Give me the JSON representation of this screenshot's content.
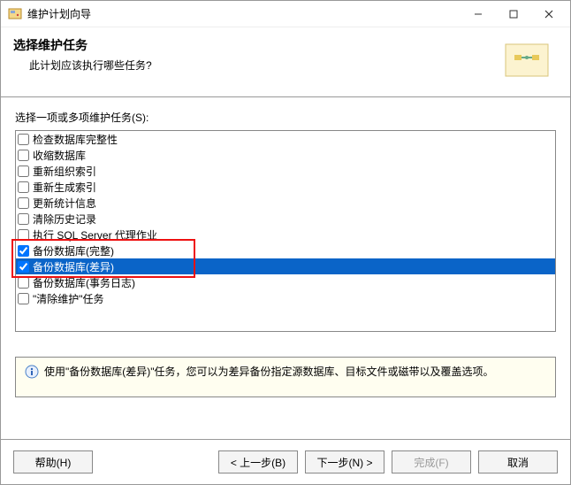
{
  "window": {
    "title": "维护计划向导"
  },
  "header": {
    "title": "选择维护任务",
    "subtitle": "此计划应该执行哪些任务?"
  },
  "list_label": "选择一项或多项维护任务(S):",
  "tasks": [
    {
      "label": "检查数据库完整性",
      "checked": false,
      "selected": false
    },
    {
      "label": "收缩数据库",
      "checked": false,
      "selected": false
    },
    {
      "label": "重新组织索引",
      "checked": false,
      "selected": false
    },
    {
      "label": "重新生成索引",
      "checked": false,
      "selected": false
    },
    {
      "label": "更新统计信息",
      "checked": false,
      "selected": false
    },
    {
      "label": "清除历史记录",
      "checked": false,
      "selected": false
    },
    {
      "label": "执行 SQL Server 代理作业",
      "checked": false,
      "selected": false
    },
    {
      "label": "备份数据库(完整)",
      "checked": true,
      "selected": false
    },
    {
      "label": "备份数据库(差异)",
      "checked": true,
      "selected": true
    },
    {
      "label": "备份数据库(事务日志)",
      "checked": false,
      "selected": false
    },
    {
      "label": "\"清除维护\"任务",
      "checked": false,
      "selected": false
    }
  ],
  "hint": "使用\"备份数据库(差异)\"任务，您可以为差异备份指定源数据库、目标文件或磁带以及覆盖选项。",
  "buttons": {
    "help": "帮助(H)",
    "back": "< 上一步(B)",
    "next": "下一步(N) >",
    "finish": "完成(F)",
    "cancel": "取消"
  },
  "highlight": {
    "visible": true
  }
}
